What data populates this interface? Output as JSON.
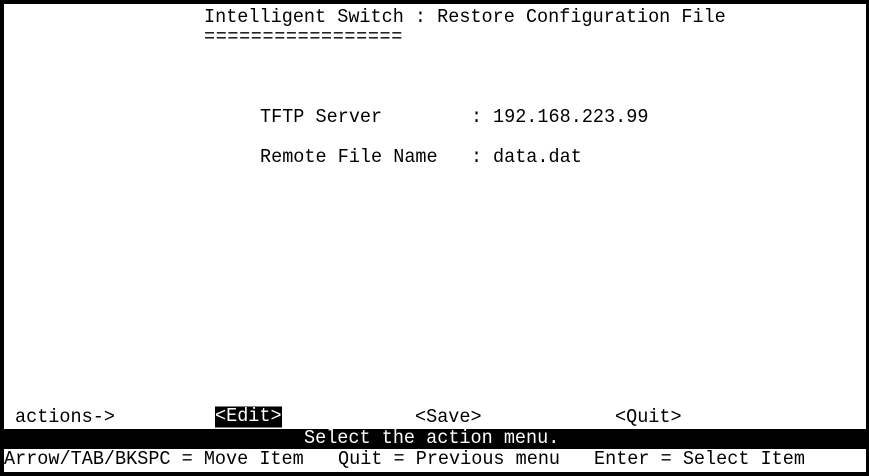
{
  "header": {
    "title": "Intelligent Switch : Restore Configuration File",
    "underline": "================="
  },
  "fields": [
    {
      "label": "TFTP Server",
      "separator": ":",
      "value": "192.168.223.99"
    },
    {
      "label": "Remote File Name",
      "separator": ":",
      "value": "data.dat"
    }
  ],
  "actions": {
    "label": "actions->",
    "items": [
      {
        "label": "<Edit>",
        "selected": true
      },
      {
        "label": "<Save>",
        "selected": false
      },
      {
        "label": "<Quit>",
        "selected": false
      }
    ]
  },
  "status": "Select the action menu.",
  "help": {
    "move": "Arrow/TAB/BKSPC = Move Item",
    "quit": "Quit = Previous menu",
    "enter": "Enter = Select Item"
  }
}
